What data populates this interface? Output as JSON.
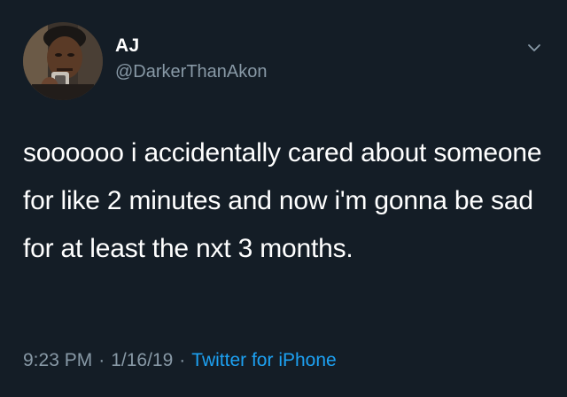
{
  "tweet": {
    "display_name": "AJ",
    "handle": "@DarkerThanAkon",
    "text": "soooooo i accidentally cared about someone for like 2 minutes and now i'm gonna be sad for at least the nxt 3 months.",
    "time": "9:23 PM",
    "date": "1/16/19",
    "separator": "·",
    "source": "Twitter for iPhone"
  },
  "icons": {
    "avatar": "profile-photo",
    "caret": "chevron-down-icon"
  },
  "colors": {
    "background": "#141d26",
    "primary_text": "#ffffff",
    "secondary_text": "#8899a6",
    "link": "#1da1f2"
  }
}
